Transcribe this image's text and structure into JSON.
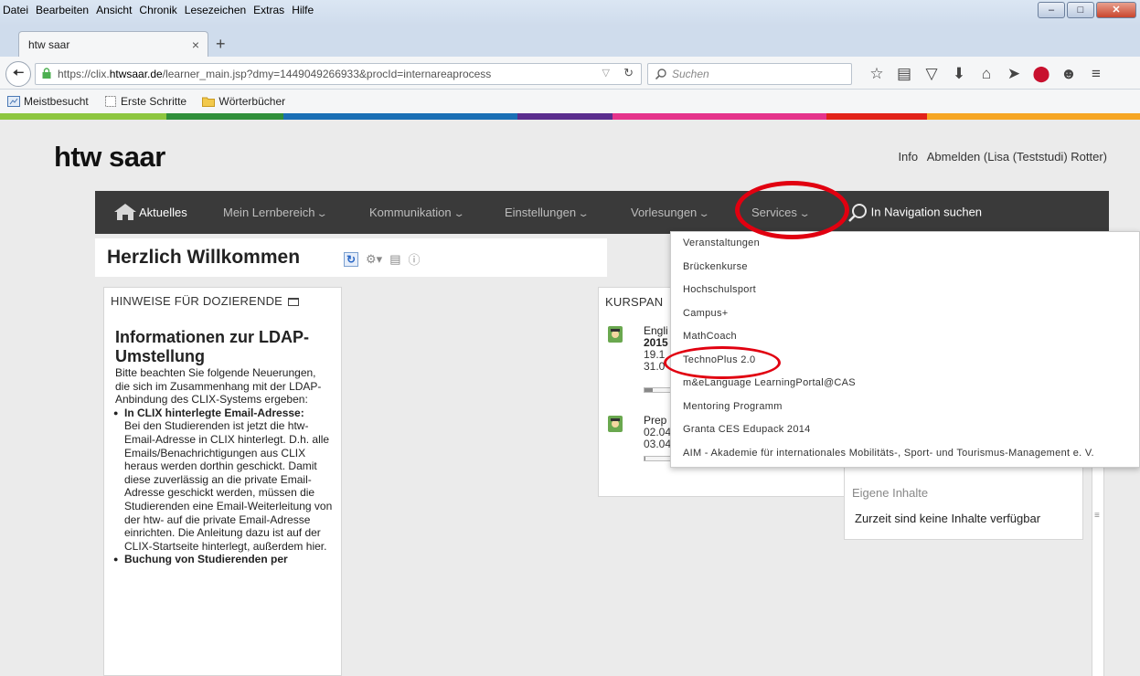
{
  "browser": {
    "menu": [
      "Datei",
      "Bearbeiten",
      "Ansicht",
      "Chronik",
      "Lesezeichen",
      "Extras",
      "Hilfe"
    ],
    "tab_title": "htw saar",
    "url_prefix": "https://clix.",
    "url_domain": "htwsaar.de",
    "url_suffix": "/learner_main.jsp?dmy=1449049266933&procId=internareaprocess",
    "search_placeholder": "Suchen",
    "bookmarks": [
      "Meistbesucht",
      "Erste Schritte",
      "Wörterbücher"
    ]
  },
  "site": {
    "logo": "htw saar",
    "info_link": "Info",
    "logout_link": "Abmelden (Lisa (Teststudi) Rotter)"
  },
  "nav": {
    "items": [
      "Aktuelles",
      "Mein Lernbereich",
      "Kommunikation",
      "Einstellungen",
      "Vorlesungen",
      "Services"
    ],
    "search": "In Navigation suchen"
  },
  "welcome": {
    "title": "Herzlich Willkommen"
  },
  "hinweise": {
    "header": "HINWEISE FÜR DOZIERENDE",
    "title": "Informationen zur LDAP-Umstellung",
    "intro": "Bitte beachten Sie folgende Neuerungen, die sich im Zusammenhang mit der LDAP-Anbindung des CLIX-Systems ergeben:",
    "item1_head": "In CLIX hinterlegte Email-Adresse:",
    "item1_body": "Bei den Studierenden ist jetzt die htw-Email-Adresse in CLIX hinterlegt. D.h. alle Emails/Benachrichtigungen aus CLIX heraus werden dorthin geschickt. Damit diese zuverlässig an die private Email-Adresse geschickt werden, müssen die Studierenden eine Email-Weiterleitung von der htw- auf die private Email-Adresse einrichten. Die Anleitung dazu ist auf der CLIX-Startseite hinterlegt, außerdem",
    "item1_link": "hier.",
    "item2_head": "Buchung von Studierenden per"
  },
  "kurs": {
    "header": "KURSPAN",
    "courses": [
      {
        "l1": "Engli",
        "l2": "2015",
        "l3": "19.1",
        "l4": "31.0",
        "progress": 0.15
      },
      {
        "l1": "Prep",
        "l2": "02.04",
        "l3": "03.04",
        "progress": 0.02
      }
    ]
  },
  "eigene": {
    "header": "Eigene Inhalte",
    "text": "Zurzeit sind keine Inhalte verfügbar"
  },
  "services_menu": [
    "Veranstaltungen",
    "Brückenkurse",
    "Hochschulsport",
    "Campus+",
    "MathCoach",
    "TechnoPlus 2.0",
    "m&eLanguage LearningPortal@CAS",
    "Mentoring Programm",
    "Granta CES Edupack 2014",
    "AIM - Akademie für internationales Mobilitäts-, Sport- und Tourismus-Management e. V."
  ],
  "colors": {
    "nav_bg": "#3a3a3a",
    "annotation": "#e10010",
    "brand_bar": [
      "#8dc63f",
      "#2f8f3a",
      "#1a6fb5",
      "#5b2d8e",
      "#e5338b",
      "#e2231a",
      "#f6a623"
    ]
  }
}
